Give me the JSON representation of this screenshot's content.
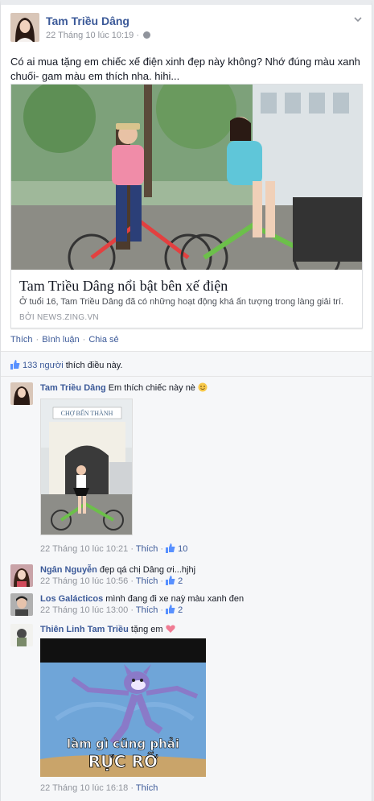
{
  "post": {
    "author": "Tam Triều Dâng",
    "timestamp": "22 Tháng 10 lúc 10:19 ·",
    "text": "Có ai mua tặng em chiếc xế điện xinh đẹp này không? Nhớ đúng màu xanh chuối- gam màu em thích  nha. hihi...",
    "share": {
      "title": "Tam Triều Dâng nổi bật bên xế điện",
      "description": "Ở tuổi 16, Tam Triều Dâng đã có những hoạt động khá ấn tượng trong làng giải trí.",
      "source": "BỞI NEWS.ZING.VN"
    },
    "actions": {
      "like": "Thích",
      "comment": "Bình luận",
      "share": "Chia sẻ"
    }
  },
  "likes": {
    "count_text": "133 người",
    "suffix": " thích điều này."
  },
  "comments": [
    {
      "name": "Tam Triều Dâng",
      "text": "Em thích chiếc này nè",
      "time": "22 Tháng 10 lúc 10:21",
      "like": "Thích",
      "likes": "10"
    },
    {
      "name": "Ngân Nguyễn",
      "text": "đẹp qá chị Dâng ơi...hjhj",
      "time": "22 Tháng 10 lúc 10:56",
      "like": "Thích",
      "likes": "2"
    },
    {
      "name": "Los Galácticos",
      "text": "mình đang đi xe naỳ màu xanh đen",
      "time": "22 Tháng 10 lúc 13:00",
      "like": "Thích",
      "likes": "2"
    },
    {
      "name": "Thiên Linh Tam Triều",
      "text": "tặng em",
      "time": "22 Tháng 10 lúc 16:18",
      "like": "Thích"
    }
  ],
  "images": {
    "comment1_sign": "CHỢ BẾN THÀNH",
    "meme_line1": "làm gì cũng phải",
    "meme_line2": "RỰC RỠ"
  },
  "colors": {
    "link": "#3b5998",
    "meta": "#90949c",
    "bg": "#f6f7f9",
    "bike_green": "#6cc04a"
  }
}
